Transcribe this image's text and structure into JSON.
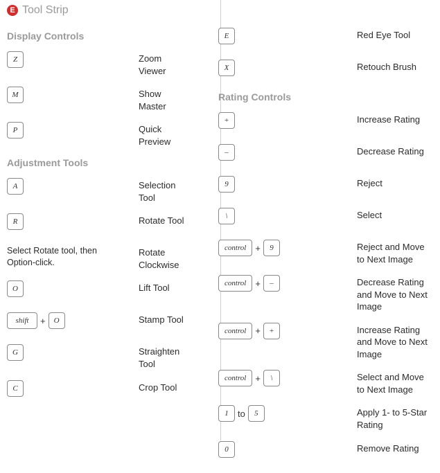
{
  "header": {
    "badge": "E",
    "title": "Tool Strip"
  },
  "left": {
    "section1": {
      "title": "Display Controls"
    },
    "r1": {
      "k1": "Z",
      "desc": "Zoom Viewer"
    },
    "r2": {
      "k1": "M",
      "desc": "Show Master"
    },
    "r3": {
      "k1": "P",
      "desc": "Quick Preview"
    },
    "section2": {
      "title": "Adjustment Tools"
    },
    "r4": {
      "k1": "A",
      "desc": "Selection Tool"
    },
    "r5": {
      "k1": "R",
      "desc": "Rotate Tool"
    },
    "r6": {
      "instr": "Select Rotate tool, then Option-click.",
      "desc": "Rotate Clockwise"
    },
    "r7": {
      "k1": "O",
      "desc": "Lift Tool"
    },
    "r8": {
      "k1": "shift",
      "plus": "+",
      "k2": "O",
      "desc": "Stamp Tool"
    },
    "r9": {
      "k1": "G",
      "desc": "Straighten Tool"
    },
    "r10": {
      "k1": "C",
      "desc": "Crop Tool"
    }
  },
  "right": {
    "r1": {
      "k1": "E",
      "desc": "Red Eye Tool"
    },
    "r2": {
      "k1": "X",
      "desc": "Retouch Brush"
    },
    "section1": {
      "title": "Rating Controls"
    },
    "r3": {
      "k1": "+",
      "desc": "Increase Rating"
    },
    "r4": {
      "k1": "–",
      "desc": "Decrease Rating"
    },
    "r5": {
      "k1": "9",
      "desc": "Reject"
    },
    "r6": {
      "k1": "\\",
      "desc": "Select"
    },
    "r7": {
      "k1": "control",
      "plus": "+",
      "k2": "9",
      "desc": "Reject and Move to Next Image"
    },
    "r8": {
      "k1": "control",
      "plus": "+",
      "k2": "–",
      "desc": "Decrease Rating and Move to Next Image"
    },
    "r9": {
      "k1": "control",
      "plus": "+",
      "k2": "+",
      "desc": "Increase Rating and Move to Next Image"
    },
    "r10": {
      "k1": "control",
      "plus": "+",
      "k2": "\\",
      "desc": "Select and Move to Next Image"
    },
    "r11": {
      "k1": "1",
      "conn": "to",
      "k2": "5",
      "desc": "Apply 1- to 5-Star Rating"
    },
    "r12": {
      "k1": "0",
      "desc": "Remove Rating"
    }
  }
}
